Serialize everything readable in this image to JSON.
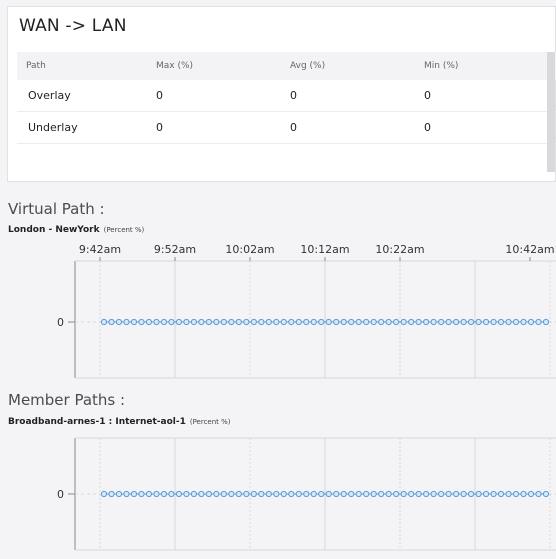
{
  "panel": {
    "title": "WAN -> LAN",
    "columns": [
      "Path",
      "Max (%)",
      "Avg (%)",
      "Min (%)"
    ],
    "rows": [
      [
        "Overlay",
        "0",
        "0",
        "0"
      ],
      [
        "Underlay",
        "0",
        "0",
        "0"
      ]
    ]
  },
  "virtual_path": {
    "section_title": "Virtual Path :",
    "chart_label": "London - NewYork",
    "unit": "(Percent %)"
  },
  "member_paths": {
    "section_title": "Member Paths :",
    "chart_label": "Broadband-arnes-1 : Internet-aol-1",
    "unit": "(Percent %)"
  },
  "colors": {
    "point": "#5b9bd5",
    "point_fill": "#d7e8f8",
    "grid": "#d8d8d8",
    "axis": "#888888"
  },
  "chart_data": [
    {
      "type": "line",
      "title": "London - NewYork",
      "ylabel": "(Percent %)",
      "x_ticks": [
        "9:42am",
        "9:52am",
        "10:02am",
        "10:12am",
        "10:22am",
        "10:42am"
      ],
      "y_ticks": [
        "0"
      ],
      "series": [
        {
          "name": "",
          "values": [
            0,
            0,
            0,
            0,
            0,
            0,
            0,
            0,
            0,
            0,
            0,
            0,
            0,
            0,
            0,
            0,
            0,
            0,
            0,
            0,
            0,
            0,
            0,
            0,
            0,
            0,
            0,
            0,
            0,
            0,
            0,
            0,
            0,
            0,
            0,
            0,
            0,
            0,
            0,
            0,
            0,
            0,
            0,
            0,
            0,
            0,
            0,
            0,
            0,
            0,
            0,
            0,
            0,
            0,
            0,
            0,
            0,
            0,
            0,
            0
          ]
        }
      ]
    },
    {
      "type": "line",
      "title": "Broadband-arnes-1 : Internet-aol-1",
      "ylabel": "(Percent %)",
      "y_ticks": [
        "0"
      ],
      "series": [
        {
          "name": "",
          "values": [
            0,
            0,
            0,
            0,
            0,
            0,
            0,
            0,
            0,
            0,
            0,
            0,
            0,
            0,
            0,
            0,
            0,
            0,
            0,
            0,
            0,
            0,
            0,
            0,
            0,
            0,
            0,
            0,
            0,
            0,
            0,
            0,
            0,
            0,
            0,
            0,
            0,
            0,
            0,
            0,
            0,
            0,
            0,
            0,
            0,
            0,
            0,
            0,
            0,
            0,
            0,
            0,
            0,
            0,
            0,
            0,
            0,
            0,
            0,
            0
          ]
        }
      ]
    }
  ]
}
